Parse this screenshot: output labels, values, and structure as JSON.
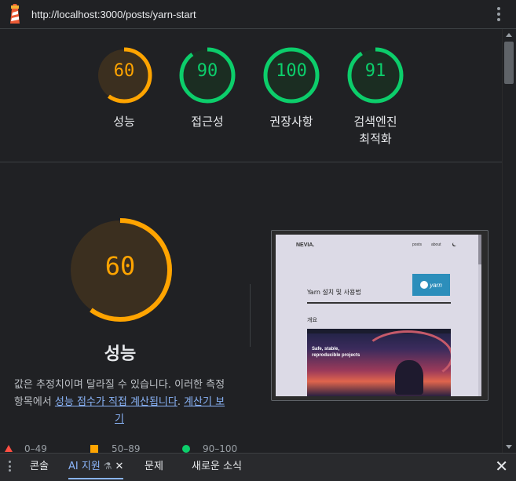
{
  "browser": {
    "url": "http://localhost:3000/posts/yarn-start",
    "icon": "lighthouse-icon",
    "menu_icon": "kebab-menu-icon"
  },
  "scores": [
    {
      "value": "60",
      "label": "성능",
      "color": "#ffa400",
      "fraction": 0.6
    },
    {
      "value": "90",
      "label": "접근성",
      "color": "#0cce6b",
      "fraction": 0.9
    },
    {
      "value": "100",
      "label": "권장사항",
      "color": "#0cce6b",
      "fraction": 1.0
    },
    {
      "value": "91",
      "label_line1": "검색엔진",
      "label_line2": "최적화",
      "color": "#0cce6b",
      "fraction": 0.91
    }
  ],
  "main_score": {
    "value": "60",
    "title": "성능",
    "color": "#ffa400",
    "fraction": 0.6,
    "desc_line1": "값은 추정치이며 달라질 수 있습니다. 이러한 측정",
    "desc_line2_prefix": "항목에서 ",
    "desc_link1": "성능 점수가 직접 계산됩니다",
    "desc_mid": ". ",
    "desc_link2": "계산기 보기",
    "desc_link2_tail": "기"
  },
  "thumbnail": {
    "logo": "NEVIA.",
    "nav_posts": "posts",
    "nav_about": "about",
    "yarn_badge": "yarn",
    "title": "Yarn 설치 및 사용법",
    "subheading": "개요",
    "hero_text": "Safe, stable, reproducible projects"
  },
  "legend": [
    {
      "range": "0–49",
      "shape": "triangle",
      "color": "#ff4e42"
    },
    {
      "range": "50–89",
      "shape": "square",
      "color": "#ffa400"
    },
    {
      "range": "90–100",
      "shape": "circle",
      "color": "#0cce6b"
    }
  ],
  "drawer": {
    "tabs": [
      {
        "label": "콘솔",
        "active": false
      },
      {
        "label": "AI 지원",
        "active": true
      },
      {
        "label": "문제",
        "active": false
      },
      {
        "label": "새로운 소식",
        "active": false
      }
    ],
    "close_label": "✕"
  }
}
